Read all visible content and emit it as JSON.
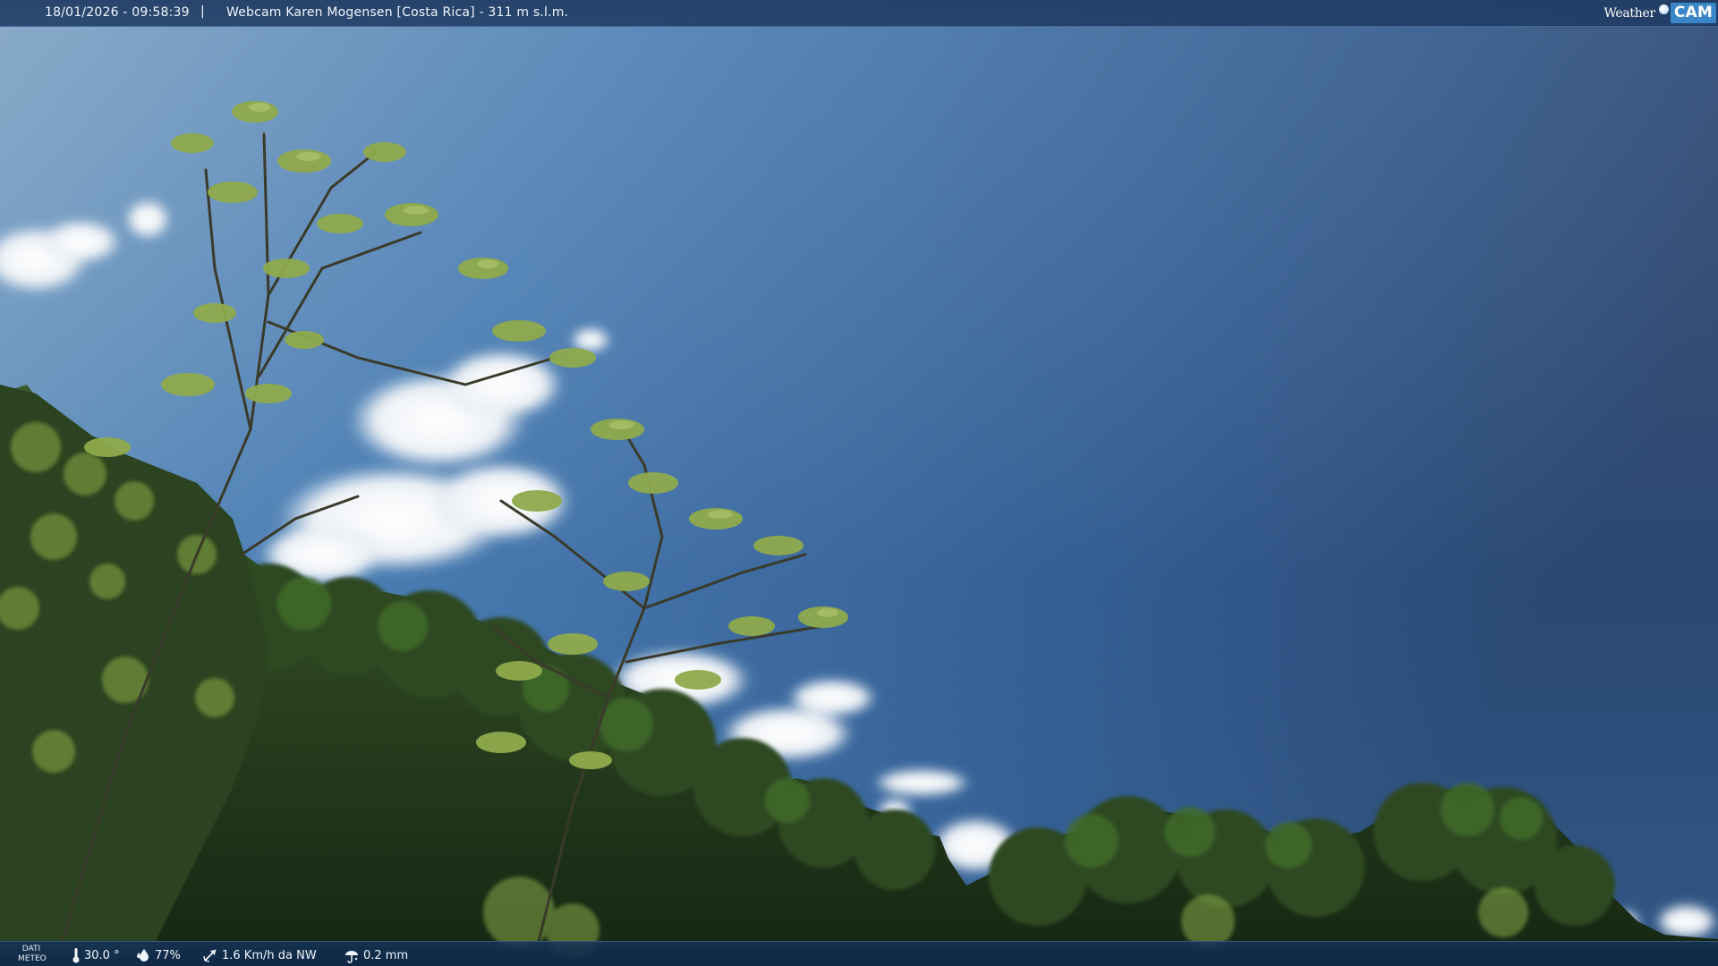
{
  "overlay": {
    "datetime": "18/01/2026 - 09:58:39",
    "separator": "|",
    "title": "Webcam Karen Mogensen [Costa Rica]  - 311 m s.l.m.",
    "brand": {
      "word": "Weather",
      "cam": "CAM"
    }
  },
  "meteo": {
    "label_line1": "DATI",
    "label_line2": "METEO",
    "temperature": "30.0 °",
    "humidity": "77%",
    "wind": "1.6 Km/h da NW",
    "rain": "0.2 mm"
  },
  "colors": {
    "sky_top": "#5f8fb8",
    "sky_right": "#27466f",
    "foliage_dark": "#1f3418",
    "foliage_light": "#8aa84a",
    "bar": "#1e3c64",
    "brand_accent": "#3a86c8"
  }
}
